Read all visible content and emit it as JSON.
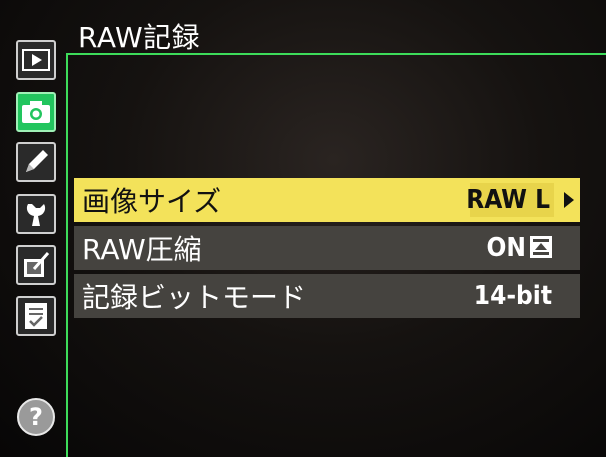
{
  "header": {
    "title": "RAW記録"
  },
  "sidebar": {
    "items": [
      {
        "icon": "playback-icon",
        "active": false
      },
      {
        "icon": "camera-icon",
        "active": true
      },
      {
        "icon": "pencil-icon",
        "active": false
      },
      {
        "icon": "wrench-icon",
        "active": false
      },
      {
        "icon": "retouch-icon",
        "active": false
      },
      {
        "icon": "my-menu-icon",
        "active": false
      }
    ],
    "help_label": "?"
  },
  "menu": {
    "items": [
      {
        "label": "画像サイズ",
        "value": "RAW L",
        "selected": true
      },
      {
        "label": "RAW圧縮",
        "value": "ON",
        "selected": false
      },
      {
        "label": "記録ビットモード",
        "value": "14-bit",
        "selected": false
      }
    ]
  },
  "colors": {
    "accent": "#3ddc5a",
    "highlight": "#f3e25a",
    "active_tab": "#22c55e"
  }
}
